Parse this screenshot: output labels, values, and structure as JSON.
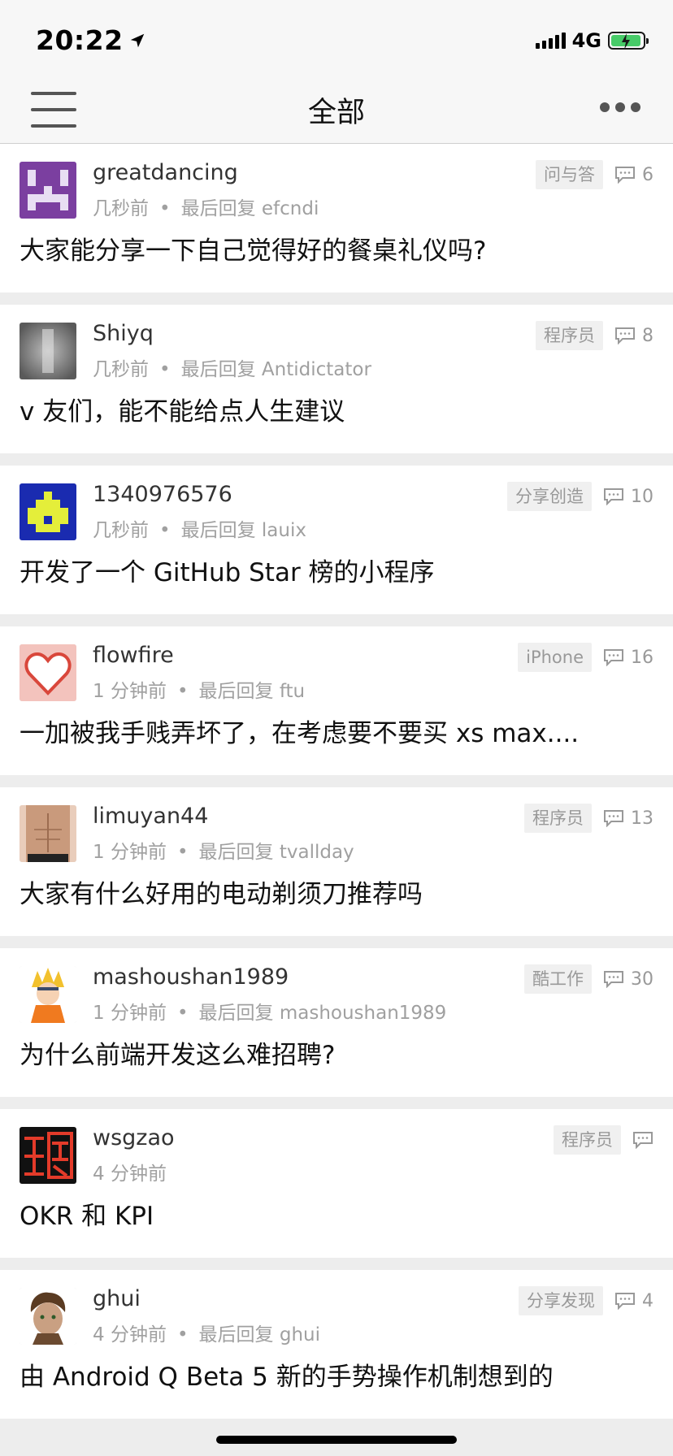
{
  "status_bar": {
    "time": "20:22",
    "network": "4G"
  },
  "nav": {
    "title": "全部"
  },
  "topics": [
    {
      "username": "greatdancing",
      "time": "几秒前",
      "last_reply": "最后回复 efcndi",
      "node": "问与答",
      "replies": "6",
      "title": "大家能分享一下自己觉得好的餐桌礼仪吗?"
    },
    {
      "username": "Shiyq",
      "time": "几秒前",
      "last_reply": "最后回复 Antidictator",
      "node": "程序员",
      "replies": "8",
      "title": "v 友们，能不能给点人生建议"
    },
    {
      "username": "1340976576",
      "time": "几秒前",
      "last_reply": "最后回复 lauix",
      "node": "分享创造",
      "replies": "10",
      "title": "开发了一个 GitHub Star 榜的小程序"
    },
    {
      "username": "flowfire",
      "time": "1 分钟前",
      "last_reply": "最后回复 ftu",
      "node": "iPhone",
      "replies": "16",
      "title": "一加被我手贱弄坏了，在考虑要不要买 xs max...."
    },
    {
      "username": "limuyan44",
      "time": "1 分钟前",
      "last_reply": "最后回复 tvallday",
      "node": "程序员",
      "replies": "13",
      "title": "大家有什么好用的电动剃须刀推荐吗"
    },
    {
      "username": "mashoushan1989",
      "time": "1 分钟前",
      "last_reply": "最后回复 mashoushan1989",
      "node": "酷工作",
      "replies": "30",
      "title": "为什么前端开发这么难招聘?"
    },
    {
      "username": "wsgzao",
      "time": "4 分钟前",
      "last_reply": "",
      "node": "程序员",
      "replies": "",
      "title": "OKR 和 KPI"
    },
    {
      "username": "ghui",
      "time": "4 分钟前",
      "last_reply": "最后回复 ghui",
      "node": "分享发现",
      "replies": "4",
      "title": "由 Android Q Beta 5 新的手势操作机制想到的"
    }
  ],
  "icons": {
    "menu": "hamburger-menu-icon",
    "more": "more-dots-icon",
    "reply": "comment-bubble-icon"
  },
  "colors": {
    "battery": "#34c759",
    "tag_bg": "#f0f0f0",
    "meta": "#a0a0a0"
  }
}
